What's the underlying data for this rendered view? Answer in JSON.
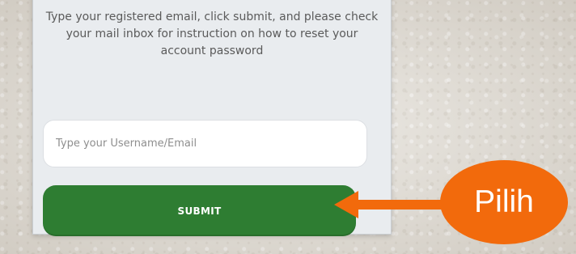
{
  "reset_form": {
    "instructions": "Type your registered email, click submit, and please check your mail inbox for instruction on how to reset your account password",
    "email_input": {
      "value": "",
      "placeholder": "Type your Username/Email"
    },
    "submit_label": "SUBMIT"
  },
  "annotation": {
    "callout_label": "Pilih",
    "arrow_icon": "left-arrow-icon"
  },
  "colors": {
    "card_background": "#e9ecef",
    "submit_button": "#2e7d32",
    "callout": "#f26a0c",
    "arrow": "#f26a0c"
  }
}
